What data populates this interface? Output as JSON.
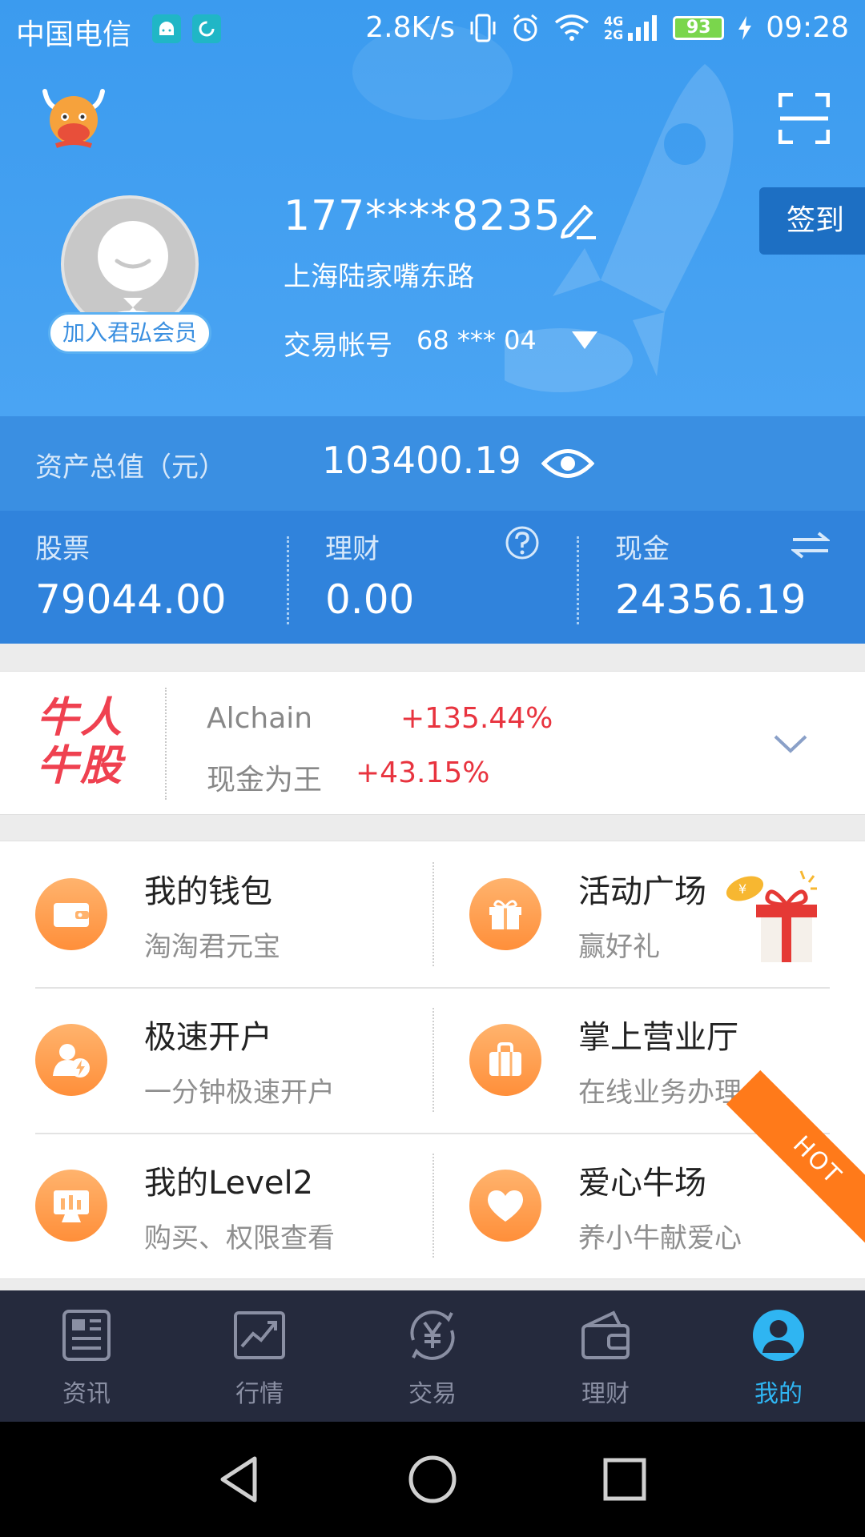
{
  "status_bar": {
    "carrier": "中国电信",
    "speed": "2.8K/s",
    "network": "4G",
    "network2": "2G",
    "battery": "93",
    "time": "09:28"
  },
  "profile": {
    "phone": "177****8235",
    "address": "上海陆家嘴东路",
    "account_label": "交易帐号",
    "account_value": "68 *** 04",
    "member_badge": "加入君弘会员",
    "signin_label": "签到"
  },
  "assets": {
    "total_label": "资产总值（元）",
    "total_value": "103400.19",
    "stock_label": "股票",
    "stock_value": "79044.00",
    "finance_label": "理财",
    "finance_value": "0.00",
    "cash_label": "现金",
    "cash_value": "24356.19"
  },
  "bull_stock": {
    "logo_line1": "牛人",
    "logo_line2": "牛股",
    "items": [
      {
        "name": "Alchain",
        "change": "+135.44%"
      },
      {
        "name": "现金为王",
        "change": "+43.15%"
      }
    ]
  },
  "menu": {
    "items": [
      {
        "title": "我的钱包",
        "subtitle": "淘淘君元宝",
        "icon": "wallet-icon"
      },
      {
        "title": "活动广场",
        "subtitle": "赢好礼",
        "icon": "gift-box-icon"
      },
      {
        "title": "极速开户",
        "subtitle": "一分钟极速开户",
        "icon": "user-lightning-icon"
      },
      {
        "title": "掌上营业厅",
        "subtitle": "在线业务办理",
        "icon": "briefcase-icon"
      },
      {
        "title": "我的Level2",
        "subtitle": "购买、权限查看",
        "icon": "monitor-chart-icon"
      },
      {
        "title": "爱心牛场",
        "subtitle": "养小牛献爱心",
        "icon": "heart-icon"
      }
    ],
    "hot_label": "HOT"
  },
  "tabs": [
    {
      "label": "资讯",
      "icon": "news-icon"
    },
    {
      "label": "行情",
      "icon": "chart-icon"
    },
    {
      "label": "交易",
      "icon": "yuan-exchange-icon"
    },
    {
      "label": "理财",
      "icon": "wallet-icon"
    },
    {
      "label": "我的",
      "icon": "person-icon",
      "active": true
    }
  ],
  "colors": {
    "header_blue": "#3b9bef",
    "asset_blue": "#3a8fe2",
    "accent_orange": "#ff8f3a",
    "gain_red": "#e8343f",
    "tab_active": "#2fb5f2",
    "tabbar_bg": "#252a3d"
  }
}
